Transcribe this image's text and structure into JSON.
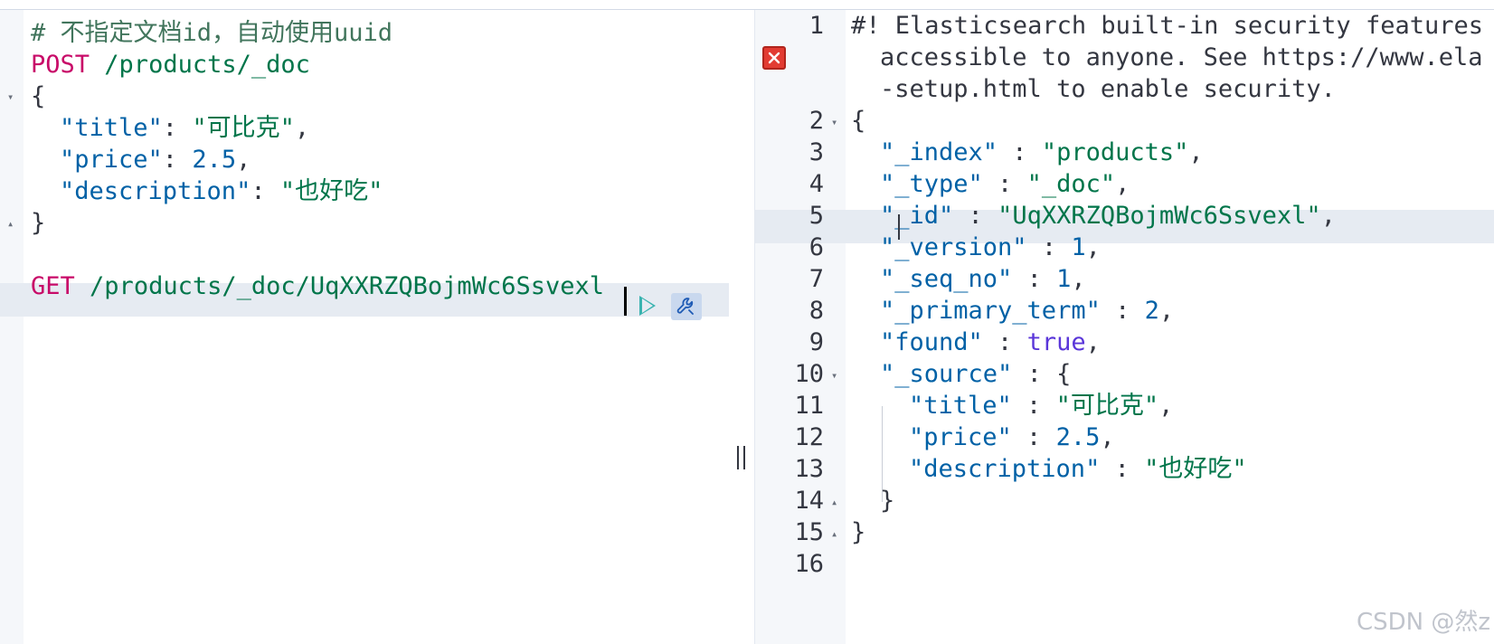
{
  "left_editor": {
    "comment": "# 不指定文档id，自动使用uuid",
    "post_method": "POST",
    "post_url": "/products/_doc",
    "open_brace": "{",
    "close_brace": "}",
    "fields": [
      {
        "key": "\"title\"",
        "sep": ": ",
        "value": "\"可比克\"",
        "type": "str",
        "trail": ","
      },
      {
        "key": "\"price\"",
        "sep": ": ",
        "value": "2.5",
        "type": "num",
        "trail": ","
      },
      {
        "key": "\"description\"",
        "sep": ": ",
        "value": "\"也好吃\"",
        "type": "str",
        "trail": ""
      }
    ],
    "get_method": "GET",
    "get_url": "/products/_doc/UqXXRZQBojmWc6Ssvexl"
  },
  "right_editor": {
    "line_numbers": [
      "1",
      "2",
      "3",
      "4",
      "5",
      "6",
      "7",
      "8",
      "9",
      "10",
      "11",
      "12",
      "13",
      "14",
      "15",
      "16"
    ],
    "warning_lines": [
      "#! Elasticsearch built-in security features",
      "accessible to anyone. See https://www.ela",
      "-setup.html to enable security."
    ],
    "open_brace": "{",
    "close_brace": "}",
    "fields": [
      {
        "key": "\"_index\"",
        "value": "\"products\"",
        "type": "str"
      },
      {
        "key": "\"_type\"",
        "value": "\"_doc\"",
        "type": "str"
      },
      {
        "key": "\"_id\"",
        "value": "\"UqXXRZQBojmWc6Ssvexl\"",
        "type": "str"
      },
      {
        "key": "\"_version\"",
        "value": "1",
        "type": "num"
      },
      {
        "key": "\"_seq_no\"",
        "value": "1",
        "type": "num"
      },
      {
        "key": "\"_primary_term\"",
        "value": "2",
        "type": "num"
      },
      {
        "key": "\"found\"",
        "value": "true",
        "type": "bool"
      }
    ],
    "source_key": "\"_source\"",
    "source_fields": [
      {
        "key": "\"title\"",
        "value": "\"可比克\"",
        "type": "str",
        "trail": ","
      },
      {
        "key": "\"price\"",
        "value": "2.5",
        "type": "num",
        "trail": ","
      },
      {
        "key": "\"description\"",
        "value": "\"也好吃\"",
        "type": "str",
        "trail": ""
      }
    ],
    "source_close": "}"
  },
  "watermark": "CSDN @然z",
  "icons": {
    "run": "play-icon",
    "settings": "wrench-icon",
    "error": "error-icon",
    "divider": "resize-grip-icon"
  },
  "colors": {
    "method": "#c80a68",
    "string": "#00754a",
    "key": "#0061a6",
    "boolean": "#5a36d9",
    "comment": "#41755c",
    "error": "#e23b32",
    "run": "#3ab3b0"
  }
}
